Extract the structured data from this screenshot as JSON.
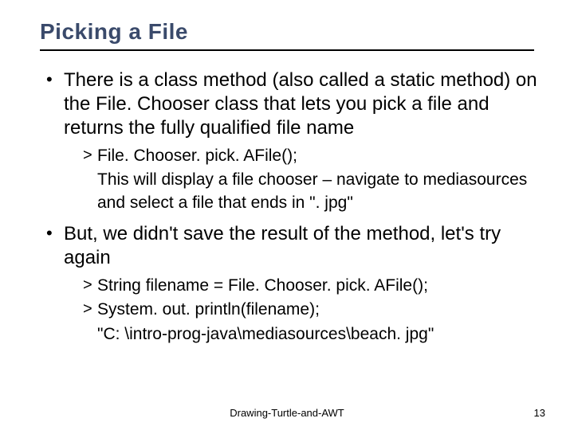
{
  "title": "Picking  a File",
  "bullets": {
    "b1": "There is a class method (also called a static method) on the File. Chooser class that lets you pick a file and returns the fully qualified file name",
    "b1_sub": {
      "s1": "File. Chooser. pick. AFile();",
      "s2": "This will display a file chooser – navigate to mediasources and select a file that ends in \". jpg\""
    },
    "b2": "But, we didn't save the result of the method, let's try again",
    "b2_sub": {
      "s1": "String filename = File. Chooser. pick. AFile();",
      "s2": "System. out. println(filename);",
      "s3": "\"C: \\intro-prog-java\\mediasources\\beach. jpg\""
    }
  },
  "footer": {
    "label": "Drawing-Turtle-and-AWT",
    "page": "13"
  }
}
